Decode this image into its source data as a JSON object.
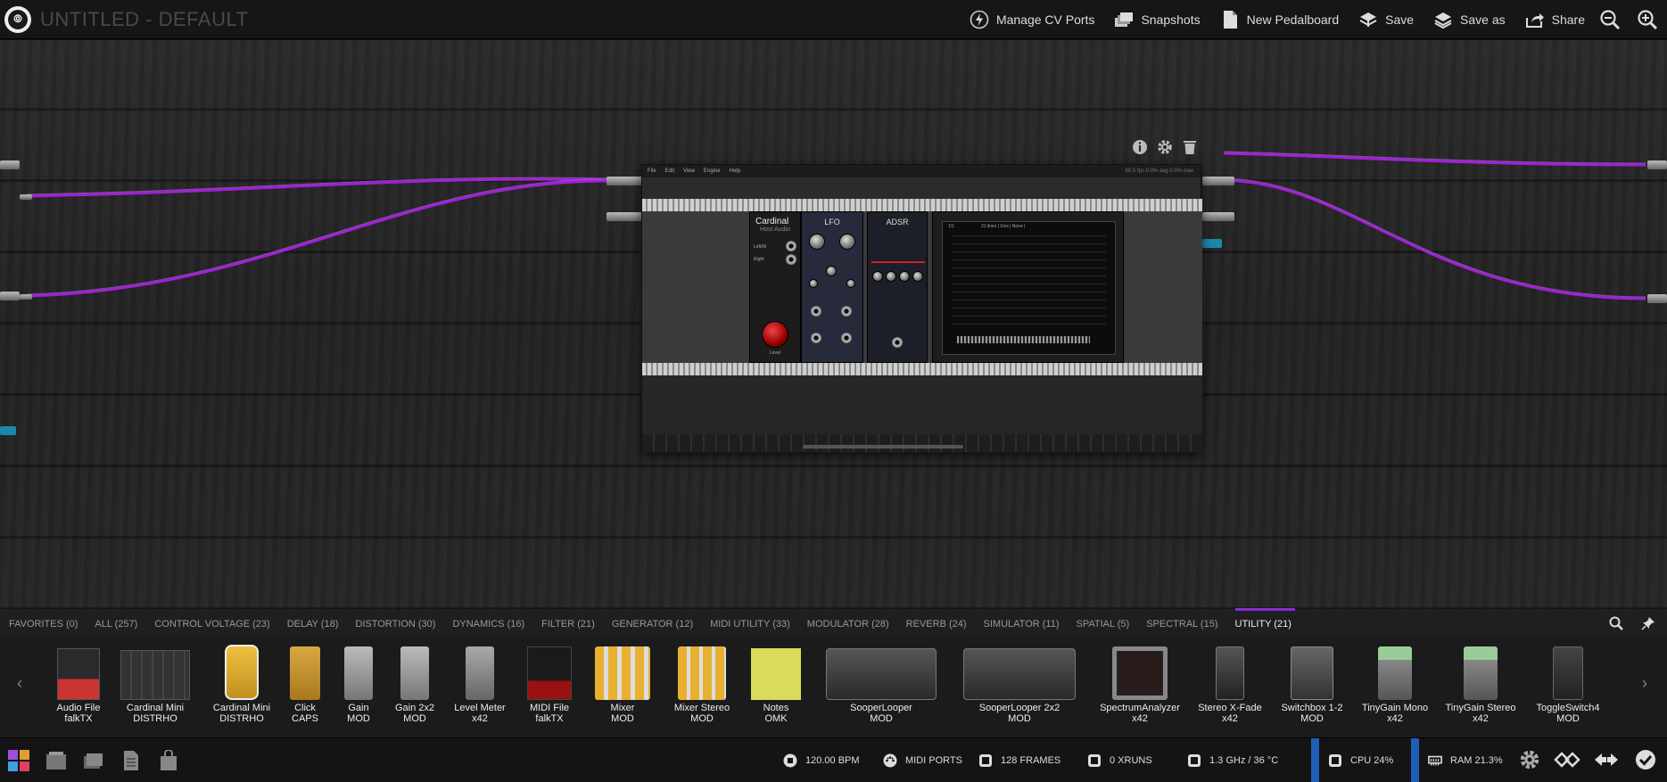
{
  "app": {
    "title": "UNTITLED - DEFAULT",
    "logo_icon": "mod-logo-icon"
  },
  "toolbar": {
    "manage_cv": "Manage CV Ports",
    "snapshots": "Snapshots",
    "new_pedalboard": "New Pedalboard",
    "save": "Save",
    "save_as": "Save as",
    "share": "Share"
  },
  "plugin_window": {
    "menu": [
      "File",
      "Edit",
      "View",
      "Engine",
      "Help"
    ],
    "perf": "60.5 fps  0.0% avg  0.0% max",
    "modules": {
      "host_audio": {
        "brand": "Cardinal",
        "name": "Host Audio",
        "in_left": "Left/M",
        "in_right": "Right",
        "knob_label": "Level"
      },
      "lfo": {
        "title": "LFO"
      },
      "adsr": {
        "title": "ADSR"
      },
      "seq": {
        "header_left": "1/1",
        "header_mid": "21 lines | 1ms | None |"
      }
    }
  },
  "categories": [
    "FAVORITES (0)",
    "ALL (257)",
    "CONTROL VOLTAGE (23)",
    "DELAY (18)",
    "DISTORTION (30)",
    "DYNAMICS (16)",
    "FILTER (21)",
    "GENERATOR (12)",
    "MIDI UTILITY (33)",
    "MODULATOR (28)",
    "REVERB (24)",
    "SIMULATOR (11)",
    "SPATIAL (5)",
    "SPECTRAL (15)",
    "UTILITY (21)"
  ],
  "active_category": "UTILITY (21)",
  "plugins": [
    {
      "name": "Audio File",
      "brand": "falkTX"
    },
    {
      "name": "Cardinal Mini",
      "brand": "DISTRHO"
    },
    {
      "name": "Cardinal Mini",
      "brand": "DISTRHO"
    },
    {
      "name": "Click",
      "brand": "CAPS"
    },
    {
      "name": "Gain",
      "brand": "MOD"
    },
    {
      "name": "Gain 2x2",
      "brand": "MOD"
    },
    {
      "name": "Level Meter",
      "brand": "x42"
    },
    {
      "name": "MIDI File",
      "brand": "falkTX"
    },
    {
      "name": "Mixer",
      "brand": "MOD"
    },
    {
      "name": "Mixer Stereo",
      "brand": "MOD"
    },
    {
      "name": "Notes",
      "brand": "OMK"
    },
    {
      "name": "SooperLooper",
      "brand": "MOD"
    },
    {
      "name": "SooperLooper 2x2",
      "brand": "MOD"
    },
    {
      "name": "SpectrumAnalyzer",
      "brand": "x42"
    },
    {
      "name": "Stereo X-Fade",
      "brand": "x42"
    },
    {
      "name": "Switchbox 1-2",
      "brand": "MOD"
    },
    {
      "name": "TinyGain Mono",
      "brand": "x42"
    },
    {
      "name": "TinyGain Stereo",
      "brand": "x42"
    },
    {
      "name": "ToggleSwitch4",
      "brand": "MOD"
    }
  ],
  "status": {
    "bpm": "120.00 BPM",
    "midi_ports": "MIDI PORTS",
    "frames": "128 FRAMES",
    "xruns": "0 XRUNS",
    "cpu_freq": "1.3 GHz / 36 °C",
    "cpu": "CPU 24%",
    "ram": "RAM 21.3%"
  },
  "colors": {
    "cable": "#a020d8",
    "accent": "#8b2bd6",
    "status_highlight": "#1f5fb8",
    "notes_yellow": "#d8dc5a"
  }
}
